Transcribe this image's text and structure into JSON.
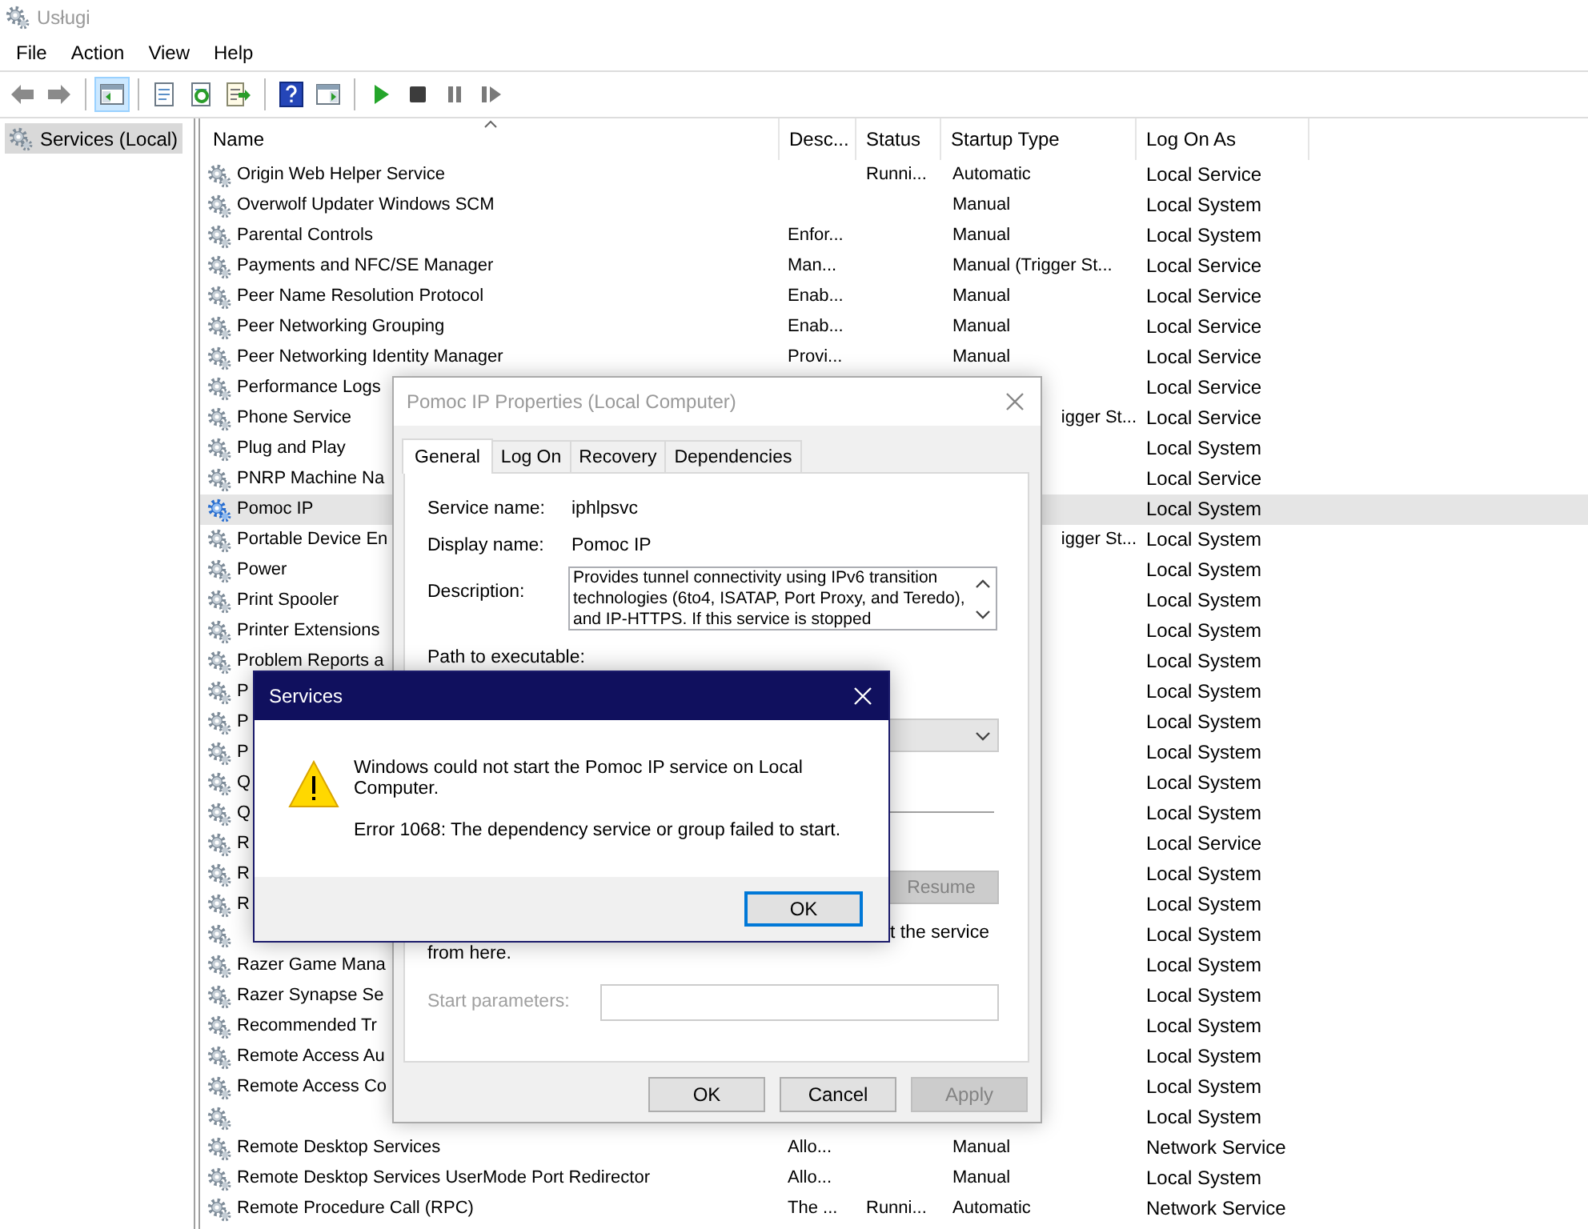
{
  "window": {
    "title": "Usługi"
  },
  "menu": [
    "File",
    "Action",
    "View",
    "Help"
  ],
  "toolbar": {
    "groups": [
      [
        {
          "kind": "back",
          "on": false
        },
        {
          "kind": "forward",
          "on": false
        }
      ],
      [
        {
          "kind": "tree",
          "on": true
        }
      ],
      [
        {
          "kind": "properties",
          "on": false
        },
        {
          "kind": "refresh",
          "on": false
        },
        {
          "kind": "export",
          "on": false
        }
      ],
      [
        {
          "kind": "help",
          "on": false
        },
        {
          "kind": "pane",
          "on": false
        }
      ],
      [
        {
          "kind": "start",
          "on": false
        },
        {
          "kind": "stop",
          "on": false
        },
        {
          "kind": "pause",
          "on": false
        },
        {
          "kind": "resume",
          "on": false
        }
      ]
    ]
  },
  "tree": {
    "items": [
      {
        "label": "Services (Local)",
        "selected": true
      }
    ]
  },
  "table": {
    "columns": [
      {
        "label": "Name",
        "sorted": true
      },
      {
        "label": "Desc...",
        "sorted": false
      },
      {
        "label": "Status",
        "sorted": false
      },
      {
        "label": "Startup Type",
        "sorted": false
      },
      {
        "label": "Log On As",
        "sorted": false
      }
    ],
    "rows": [
      {
        "kind": "full",
        "name": "Origin Web Helper Service",
        "status": "Runni...",
        "startup_type": "Automatic",
        "log_on_as": "Local Service",
        "selected": false
      },
      {
        "kind": "full",
        "name": "Overwolf Updater Windows SCM",
        "startup_type": "Manual",
        "log_on_as": "Local System",
        "selected": false
      },
      {
        "kind": "full",
        "name": "Parental Controls",
        "description": "Enfor...",
        "startup_type": "Manual",
        "log_on_as": "Local System",
        "selected": false
      },
      {
        "kind": "full",
        "name": "Payments and NFC/SE Manager",
        "description": "Man...",
        "startup_type": "Manual (Trigger St...",
        "log_on_as": "Local Service",
        "selected": false
      },
      {
        "kind": "full",
        "name": "Peer Name Resolution Protocol",
        "description": "Enab...",
        "startup_type": "Manual",
        "log_on_as": "Local Service",
        "selected": false
      },
      {
        "kind": "full",
        "name": "Peer Networking Grouping",
        "description": "Enab...",
        "startup_type": "Manual",
        "log_on_as": "Local Service",
        "selected": false
      },
      {
        "kind": "full",
        "name": "Peer Networking Identity Manager",
        "description": "Provi...",
        "startup_type": "Manual",
        "log_on_as": "Local Service",
        "selected": false
      },
      {
        "kind": "full",
        "name": "Performance Logs",
        "log_on_as": "Local Service",
        "selected": false
      },
      {
        "kind": "covered",
        "name": "Phone Service",
        "startup_type": "igger St...",
        "log_on_as": "Local Service",
        "selected": false
      },
      {
        "kind": "full",
        "name": "Plug and Play",
        "log_on_as": "Local System",
        "selected": false
      },
      {
        "kind": "full",
        "name": "PNRP Machine Na",
        "log_on_as": "Local Service",
        "selected": false
      },
      {
        "kind": "full",
        "name": "Pomoc IP",
        "log_on_as": "Local System",
        "selected": true
      },
      {
        "kind": "covered",
        "name": "Portable Device En",
        "startup_type": "igger St...",
        "log_on_as": "Local System",
        "selected": false
      },
      {
        "kind": "full",
        "name": "Power",
        "log_on_as": "Local System",
        "selected": false
      },
      {
        "kind": "full",
        "name": "Print Spooler",
        "log_on_as": "Local System",
        "selected": false
      },
      {
        "kind": "full",
        "name": "Printer Extensions",
        "log_on_as": "Local System",
        "selected": false
      },
      {
        "kind": "full",
        "name": "Problem Reports a",
        "log_on_as": "Local System",
        "selected": false
      },
      {
        "kind": "full",
        "name": "P",
        "log_on_as": "Local System",
        "selected": false
      },
      {
        "kind": "full",
        "name": "P",
        "log_on_as": "Local System",
        "selected": false
      },
      {
        "kind": "full",
        "name": "P",
        "log_on_as": "Local System",
        "selected": false
      },
      {
        "kind": "full",
        "name": "Q",
        "log_on_as": "Local System",
        "selected": false
      },
      {
        "kind": "full",
        "name": "Q",
        "log_on_as": "Local System",
        "selected": false
      },
      {
        "kind": "full",
        "name": "R",
        "log_on_as": "Local Service",
        "selected": false
      },
      {
        "kind": "full",
        "name": "R",
        "log_on_as": "Local System",
        "selected": false
      },
      {
        "kind": "full",
        "name": "R",
        "log_on_as": "Local System",
        "selected": false
      },
      {
        "kind": "full",
        "log_on_as": "Local System",
        "selected": false
      },
      {
        "kind": "full",
        "name": "Razer Game Mana",
        "log_on_as": "Local System",
        "selected": false
      },
      {
        "kind": "full",
        "name": "Razer Synapse Se",
        "log_on_as": "Local System",
        "selected": false
      },
      {
        "kind": "full",
        "name": "Recommended Tr",
        "log_on_as": "Local System",
        "selected": false
      },
      {
        "kind": "full",
        "name": "Remote Access Au",
        "log_on_as": "Local System",
        "selected": false
      },
      {
        "kind": "full",
        "name": "Remote Access Co",
        "log_on_as": "Local System",
        "selected": false
      },
      {
        "kind": "full",
        "log_on_as": "Local System",
        "selected": false
      },
      {
        "kind": "full",
        "name": "Remote Desktop Services",
        "description": "Allo...",
        "startup_type": "Manual",
        "log_on_as": "Network Service",
        "selected": false
      },
      {
        "kind": "full",
        "name": "Remote Desktop Services UserMode Port Redirector",
        "description": "Allo...",
        "startup_type": "Manual",
        "log_on_as": "Local System",
        "selected": false
      },
      {
        "kind": "full",
        "name": "Remote Procedure Call (RPC)",
        "description": "The ...",
        "status": "Runni...",
        "startup_type": "Automatic",
        "log_on_as": "Network Service",
        "selected": false
      }
    ]
  },
  "properties_dialog": {
    "title": "Pomoc IP Properties (Local Computer)",
    "active": false,
    "tabs": [
      {
        "label": "General",
        "selected": true
      },
      {
        "label": "Log On",
        "selected": false
      },
      {
        "label": "Recovery",
        "selected": false
      },
      {
        "label": "Dependencies",
        "selected": false
      }
    ],
    "fields": [
      {
        "label": "Service name:",
        "value": "iphlpsvc"
      },
      {
        "label": "Display name:",
        "value": "Pomoc IP"
      }
    ],
    "description": {
      "label": "Description:",
      "value": "Provides tunnel connectivity using IPv6 transition technologies (6to4, ISATAP, Port Proxy, and Teredo), and IP-HTTPS. If this service is stopped"
    },
    "path_label": "Path to executable:",
    "resume_button": {
      "label": "Resume",
      "disabled": true
    },
    "hint_fragments": [
      "t the service",
      "from here."
    ],
    "start_parameters": {
      "label": "Start parameters:",
      "disabled": true
    },
    "buttons": [
      {
        "label": "OK",
        "disabled": false
      },
      {
        "label": "Cancel",
        "disabled": false
      },
      {
        "label": "Apply",
        "disabled": true
      }
    ]
  },
  "error_dialog": {
    "title": "Services",
    "message": "Windows could not start the Pomoc IP service on Local Computer.",
    "detail": "Error 1068: The dependency service or group failed to start.",
    "buttons": [
      {
        "label": "OK",
        "default": true
      }
    ]
  }
}
